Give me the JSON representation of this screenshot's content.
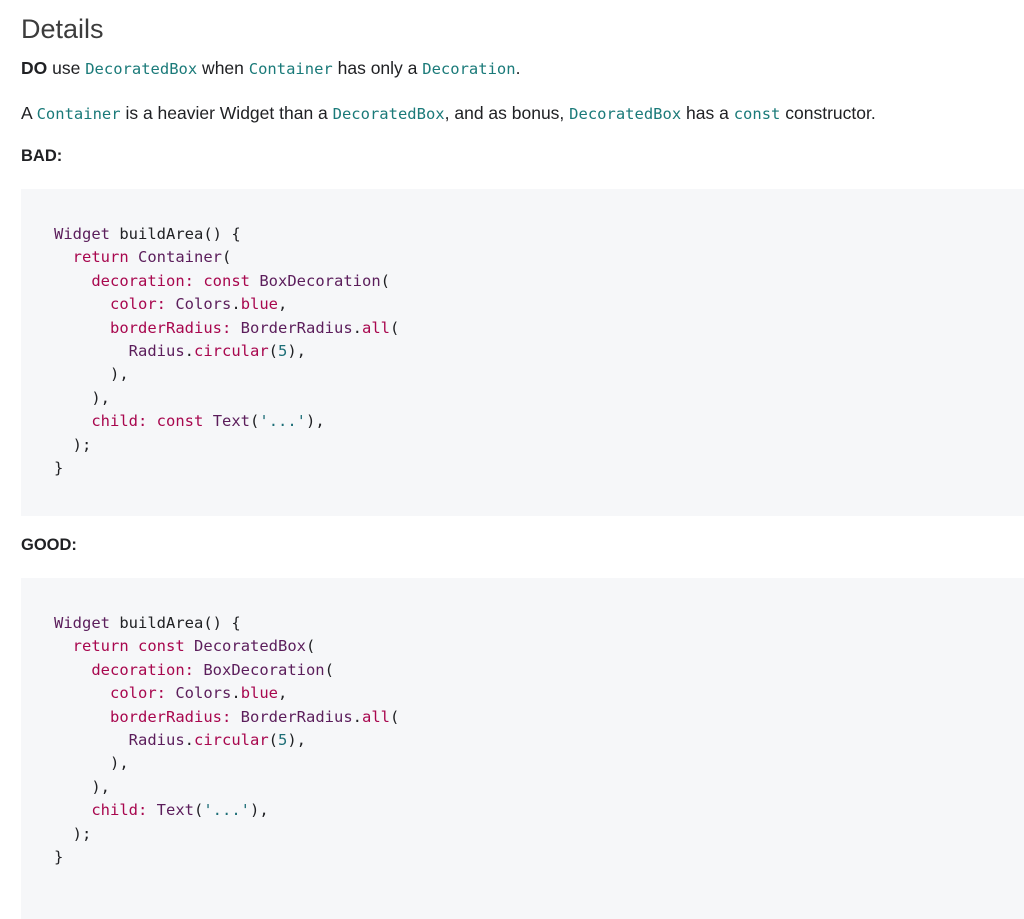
{
  "heading": "Details",
  "rule": {
    "prefix_bold": "DO",
    "t1": " use ",
    "c1": "DecoratedBox",
    "t2": " when ",
    "c2": "Container",
    "t3": " has only a ",
    "c3": "Decoration",
    "t4": "."
  },
  "explanation": {
    "t1": "A ",
    "c1": "Container",
    "t2": " is a heavier Widget than a ",
    "c2": "DecoratedBox",
    "t3": ", and as bonus, ",
    "c3": "DecoratedBox",
    "t4": " has a ",
    "c4": "const",
    "t5": " constructor."
  },
  "colors": {
    "inline_code": "#1a7a79",
    "code_bg": "#f6f7f9",
    "keyword": "#a8074e",
    "type": "#5b1d5b",
    "number": "#1d6e77"
  },
  "bad": {
    "label": "BAD:",
    "lines": [
      [
        [
          "type",
          "Widget"
        ],
        [
          "plain",
          " buildArea() {"
        ]
      ],
      [
        [
          "plain",
          "  "
        ],
        [
          "kw",
          "return"
        ],
        [
          "plain",
          " "
        ],
        [
          "type",
          "Container"
        ],
        [
          "plain",
          "("
        ]
      ],
      [
        [
          "plain",
          "    "
        ],
        [
          "prop",
          "decoration:"
        ],
        [
          "plain",
          " "
        ],
        [
          "kw",
          "const"
        ],
        [
          "plain",
          " "
        ],
        [
          "type",
          "BoxDecoration"
        ],
        [
          "plain",
          "("
        ]
      ],
      [
        [
          "plain",
          "      "
        ],
        [
          "prop",
          "color:"
        ],
        [
          "plain",
          " "
        ],
        [
          "type",
          "Colors"
        ],
        [
          "plain",
          "."
        ],
        [
          "prop",
          "blue"
        ],
        [
          "plain",
          ","
        ]
      ],
      [
        [
          "plain",
          "      "
        ],
        [
          "prop",
          "borderRadius:"
        ],
        [
          "plain",
          " "
        ],
        [
          "type",
          "BorderRadius"
        ],
        [
          "plain",
          "."
        ],
        [
          "prop",
          "all"
        ],
        [
          "plain",
          "("
        ]
      ],
      [
        [
          "plain",
          "        "
        ],
        [
          "type",
          "Radius"
        ],
        [
          "plain",
          "."
        ],
        [
          "prop",
          "circular"
        ],
        [
          "plain",
          "("
        ],
        [
          "num",
          "5"
        ],
        [
          "plain",
          "),"
        ]
      ],
      [
        [
          "plain",
          "      ),"
        ]
      ],
      [
        [
          "plain",
          "    ),"
        ]
      ],
      [
        [
          "plain",
          "    "
        ],
        [
          "prop",
          "child:"
        ],
        [
          "plain",
          " "
        ],
        [
          "kw",
          "const"
        ],
        [
          "plain",
          " "
        ],
        [
          "type",
          "Text"
        ],
        [
          "plain",
          "("
        ],
        [
          "str",
          "'...'"
        ],
        [
          "plain",
          "),"
        ]
      ],
      [
        [
          "plain",
          "  );"
        ]
      ],
      [
        [
          "plain",
          "}"
        ]
      ]
    ]
  },
  "good": {
    "label": "GOOD:",
    "lines": [
      [
        [
          "type",
          "Widget"
        ],
        [
          "plain",
          " buildArea() {"
        ]
      ],
      [
        [
          "plain",
          "  "
        ],
        [
          "kw",
          "return"
        ],
        [
          "plain",
          " "
        ],
        [
          "kw",
          "const"
        ],
        [
          "plain",
          " "
        ],
        [
          "type",
          "DecoratedBox"
        ],
        [
          "plain",
          "("
        ]
      ],
      [
        [
          "plain",
          "    "
        ],
        [
          "prop",
          "decoration:"
        ],
        [
          "plain",
          " "
        ],
        [
          "type",
          "BoxDecoration"
        ],
        [
          "plain",
          "("
        ]
      ],
      [
        [
          "plain",
          "      "
        ],
        [
          "prop",
          "color:"
        ],
        [
          "plain",
          " "
        ],
        [
          "type",
          "Colors"
        ],
        [
          "plain",
          "."
        ],
        [
          "prop",
          "blue"
        ],
        [
          "plain",
          ","
        ]
      ],
      [
        [
          "plain",
          "      "
        ],
        [
          "prop",
          "borderRadius:"
        ],
        [
          "plain",
          " "
        ],
        [
          "type",
          "BorderRadius"
        ],
        [
          "plain",
          "."
        ],
        [
          "prop",
          "all"
        ],
        [
          "plain",
          "("
        ]
      ],
      [
        [
          "plain",
          "        "
        ],
        [
          "type",
          "Radius"
        ],
        [
          "plain",
          "."
        ],
        [
          "prop",
          "circular"
        ],
        [
          "plain",
          "("
        ],
        [
          "num",
          "5"
        ],
        [
          "plain",
          "),"
        ]
      ],
      [
        [
          "plain",
          "      ),"
        ]
      ],
      [
        [
          "plain",
          "    ),"
        ]
      ],
      [
        [
          "plain",
          "    "
        ],
        [
          "prop",
          "child:"
        ],
        [
          "plain",
          " "
        ],
        [
          "type",
          "Text"
        ],
        [
          "plain",
          "("
        ],
        [
          "str",
          "'...'"
        ],
        [
          "plain",
          "),"
        ]
      ],
      [
        [
          "plain",
          "  );"
        ]
      ],
      [
        [
          "plain",
          "}"
        ]
      ]
    ]
  }
}
